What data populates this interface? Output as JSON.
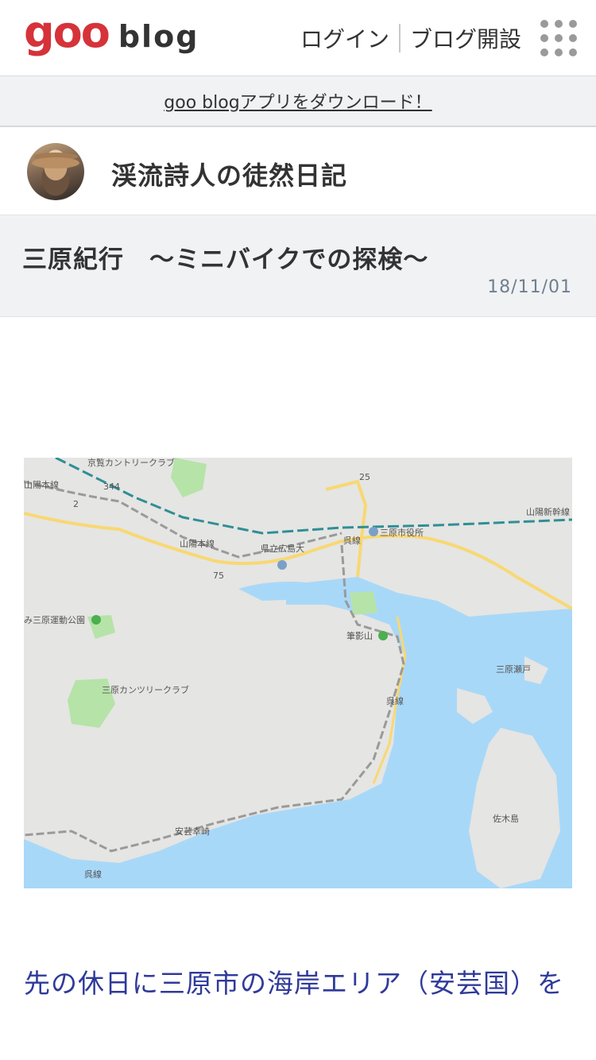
{
  "header": {
    "logo_goo": "goo",
    "logo_blog": "blog",
    "login_label": "ログイン",
    "create_blog_label": "ブログ開設",
    "menu_icon": "grid-menu-icon"
  },
  "app_banner": {
    "text": "goo blogアプリをダウンロード！"
  },
  "blog": {
    "title": "渓流詩人の徒然日記"
  },
  "article": {
    "title": "三原紀行　～ミニバイクでの探検～",
    "date": "18/11/01",
    "intro_text": "先の休日に三原市の海岸エリア（安芸国）を"
  },
  "map": {
    "labels": {
      "country_club_1": "京覧カントリークラブ",
      "sanyo_line_left": "山陽本線",
      "route_344": "344",
      "route_2": "2",
      "route_25": "25",
      "shinkansen": "山陽新幹線",
      "city_hall": "三原市役所",
      "university": "県立広島大",
      "sanyo_line": "山陽本線",
      "route_75": "75",
      "sports_park": "み三原運動公園",
      "fudekage": "筆影山",
      "country_club_2": "三原カンツリークラブ",
      "kure_line_1": "呉線",
      "kure_line_2": "呉線",
      "kure_line_3": "呉線",
      "aki_saiwaizaki": "安芸幸崎",
      "sagishima": "佐木島",
      "strait": "三原瀬戸"
    }
  },
  "colors": {
    "goo_red": "#d6323a",
    "link_blue": "#2f3a9a",
    "date_gray": "#6f7f8f",
    "sea": "#a8d8f8",
    "land": "#e5e5e3",
    "park": "#b6e3a8",
    "road": "#f8d873"
  }
}
